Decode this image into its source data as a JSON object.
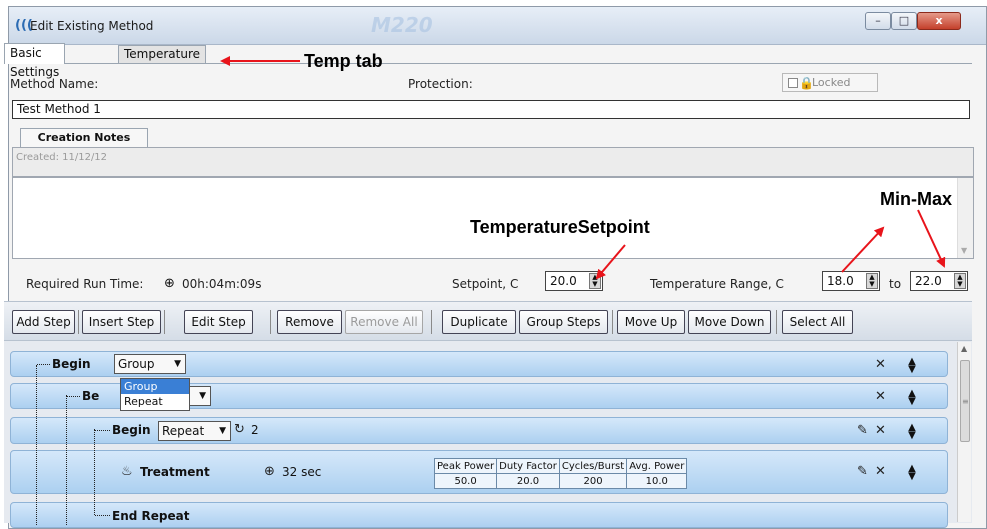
{
  "window": {
    "title": "Edit Existing Method",
    "ghost_logo": "M220",
    "controls": {
      "minimize": "–",
      "maximize": "□",
      "close": "x"
    }
  },
  "tabs": [
    {
      "label": "Basic Settings",
      "active": true
    },
    {
      "label": "Temperature",
      "active": false
    }
  ],
  "form": {
    "method_name_label": "Method Name:",
    "protection_label": "Protection:",
    "locked_label": "Locked",
    "locked_checked": false,
    "method_name_value": "Test Method 1",
    "creation_notes_tab": "Creation Notes",
    "created_text": "Created: 11/12/12",
    "notes_body": ""
  },
  "run": {
    "required_run_time_label": "Required Run Time:",
    "required_run_time_value": "00h:04m:09s",
    "setpoint_label": "Setpoint, C",
    "setpoint_value": "20.0",
    "range_label": "Temperature Range, C",
    "range_min": "18.0",
    "to_label": "to",
    "range_max": "22.0"
  },
  "toolbar": {
    "add_step": "Add Step",
    "insert_step": "Insert Step",
    "edit_step": "Edit Step",
    "remove": "Remove",
    "remove_all": "Remove All",
    "duplicate": "Duplicate",
    "group_steps": "Group Steps",
    "move_up": "Move Up",
    "move_down": "Move Down",
    "select_all": "Select All"
  },
  "steps": {
    "row1": {
      "name": "Begin",
      "type": "Group"
    },
    "dropdown_options": [
      "Group",
      "Repeat"
    ],
    "dropdown_selected": "Group",
    "row2": {
      "name_visible": "Be"
    },
    "row3": {
      "name": "Begin",
      "type": "Repeat",
      "repeat_count": "2"
    },
    "row4": {
      "name": "Treatment",
      "duration": "32 sec",
      "table_headers": [
        "Peak Power",
        "Duty Factor",
        "Cycles/Burst",
        "Avg. Power"
      ],
      "table_values": [
        "50.0",
        "20.0",
        "200",
        "10.0"
      ]
    },
    "row5": {
      "name": "End Repeat"
    }
  },
  "annotations": {
    "temp_tab": "Temp tab",
    "temperature_setpoint": "TemperatureSetpoint",
    "min_max": "Min-Max",
    "arrow_color": "#e8141b"
  }
}
